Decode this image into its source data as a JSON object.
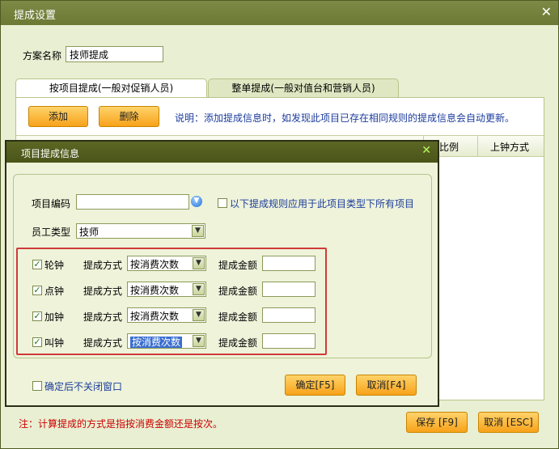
{
  "window": {
    "title": "提成设置",
    "close": "✕"
  },
  "plan": {
    "label": "方案名称",
    "value": "技师提成"
  },
  "tabs": [
    {
      "label": "按项目提成(一般对促销人员)"
    },
    {
      "label": "整单提成(一般对值台和营销人员)"
    }
  ],
  "toolbar": {
    "add_label": "添加",
    "delete_label": "删除",
    "note": "说明：添加提成信息时，如发现此项目已存在相同规则的提成信息会自动更新。"
  },
  "table": {
    "col_ratio": "比例",
    "col_mode": "上钟方式"
  },
  "footer": {
    "note": "注：计算提成的方式是指按消费金额还是按次。",
    "save_label": "保存 [F9]",
    "cancel_label": "取消 [ESC]"
  },
  "dialog": {
    "title": "项目提成信息",
    "close": "✕",
    "item_code_label": "项目编码",
    "item_code_value": "",
    "apply_all_label": "以下提成规则应用于此项目类型下所有项目",
    "staff_type_label": "员工类型",
    "staff_type_value": "技师",
    "rows": [
      {
        "name": "轮钟",
        "mode_label": "提成方式",
        "mode": "按消费次数",
        "amount_label": "提成金额",
        "amount": "",
        "checked": true
      },
      {
        "name": "点钟",
        "mode_label": "提成方式",
        "mode": "按消费次数",
        "amount_label": "提成金额",
        "amount": "",
        "checked": true
      },
      {
        "name": "加钟",
        "mode_label": "提成方式",
        "mode": "按消费次数",
        "amount_label": "提成金额",
        "amount": "",
        "checked": true
      },
      {
        "name": "叫钟",
        "mode_label": "提成方式",
        "mode": "按消费次数",
        "amount_label": "提成金额",
        "amount": "",
        "checked": true
      }
    ],
    "keep_open_label": "确定后不关闭窗口",
    "ok_label": "确定[F5]",
    "cancel_label": "取消[F4]"
  }
}
